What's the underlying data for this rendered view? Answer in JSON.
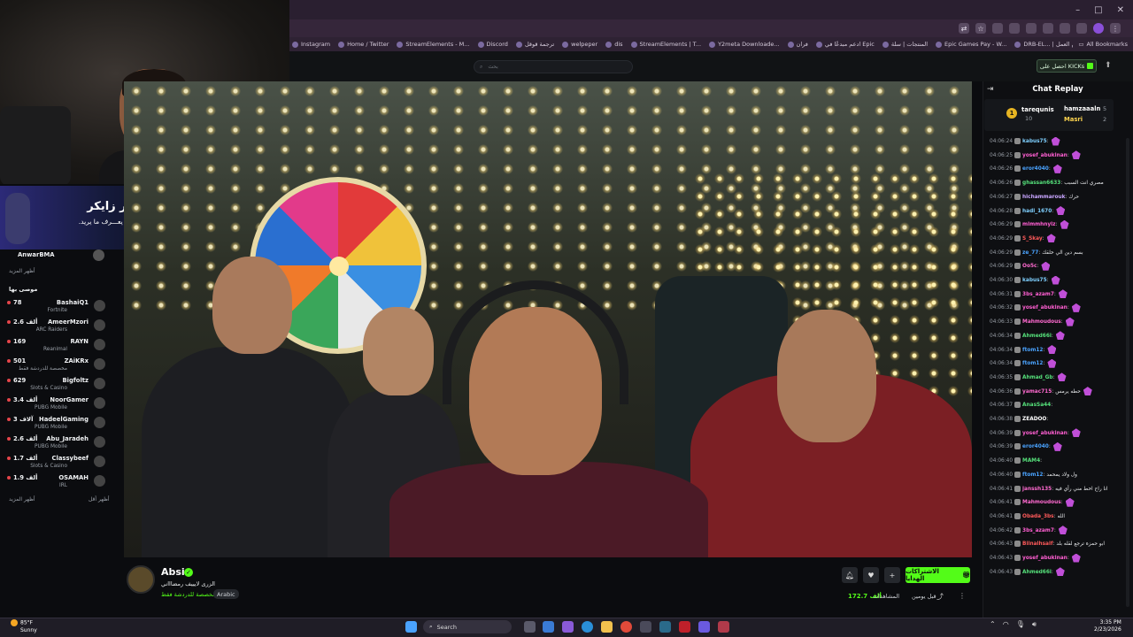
{
  "browser": {
    "bookmarks": [
      "Instagram",
      "Home / Twitter",
      "StreamElements - M...",
      "Discord",
      "ترجمة قوقل",
      "welpeper",
      "dis",
      "StreamElements | T...",
      "Y2meta Downloade...",
      "فران",
      "ادعم مبدعًا في Epic",
      "المنتجات | سلة",
      "Epic Games Pay - W...",
      "DRB-EL... | نقام العمل"
    ],
    "all_bookmarks": "All Bookmarks"
  },
  "header": {
    "search_placeholder": "بحث",
    "kick_button": "احصل على KICKs"
  },
  "store_banner": {
    "title": "متجر زايكر",
    "subtitle": "خيار من يعـــرف ما يريد."
  },
  "sidebar": {
    "top_item": "AnwarBMA",
    "show_more_top": "أظهر المزيد",
    "recommended_header": "موصى بها",
    "items": [
      {
        "count": "78",
        "name": "BashaiQ1",
        "category": "Fortnite",
        "avatar": "#6b6b6b"
      },
      {
        "count": "2.6 ألف",
        "name": "AmeerMzori",
        "category": "ARC Raiders",
        "avatar": "#b8322c"
      },
      {
        "count": "169",
        "name": "RAYN",
        "category": "Reanimal",
        "avatar": "#dcdcdc"
      },
      {
        "count": "501",
        "name": "ZAiKRx",
        "category": "مخصصة للدردشة فقط",
        "avatar": "#1a1a1a"
      },
      {
        "count": "629",
        "name": "Bigfoltz",
        "category": "Slots & Casino",
        "avatar": "#c4283a"
      },
      {
        "count": "3.4 ألف",
        "name": "NoorGamer",
        "category": "PUBG Mobile",
        "avatar": "#2a2a2a"
      },
      {
        "count": "3 آلاف",
        "name": "HadeelGaming",
        "category": "PUBG Mobile",
        "avatar": "#a56a4e"
      },
      {
        "count": "2.6 ألف",
        "name": "Abu_Jaradeh",
        "category": "PUBG Mobile",
        "avatar": "#3f8a3c"
      },
      {
        "count": "1.7 ألف",
        "name": "Classybeef",
        "category": "Slots & Casino",
        "avatar": "#2b3a7a"
      },
      {
        "count": "1.9 ألف",
        "name": "OSAMAH",
        "category": "IRL",
        "avatar": "#d0d0d0"
      }
    ],
    "show_more": "أظهر المزيد",
    "show_less": "أظهر أقل"
  },
  "stream": {
    "streamer": "Absi",
    "title": "الزرى لايييف رمضاااني",
    "category": "مخصصة للدردشة فقط",
    "language": "Arabic",
    "subscribe_button": "الاشتراكات الهدايا",
    "viewers": "172.7 ألف",
    "viewers_label": "المشاهدات",
    "uptime": "قبل يومين"
  },
  "chat": {
    "title": "Chat Replay",
    "leaderboard": [
      {
        "rank": "1",
        "name": "tarequnis",
        "count": "10"
      },
      {
        "name": "hamzaaaln",
        "count": "5"
      },
      {
        "name": "Masri",
        "count": "2"
      }
    ],
    "messages": [
      {
        "time": "04:06:24",
        "user": "kabus75",
        "color": "#7fd0ff",
        "emote": true,
        "text": ""
      },
      {
        "time": "04:06:25",
        "user": "yosef_abukinan",
        "color": "#ff5fd2",
        "emote": true,
        "text": ""
      },
      {
        "time": "04:06:26",
        "user": "eror4040",
        "color": "#4aa3ff",
        "emote": true,
        "text": ""
      },
      {
        "time": "04:06:26",
        "user": "ghassan6633",
        "color": "#55e07a",
        "emote": false,
        "text": "مصري انت السبب"
      },
      {
        "time": "04:06:27",
        "user": "hichammarouk",
        "color": "#c9a6ff",
        "emote": false,
        "text": "حرك"
      },
      {
        "time": "04:06:28",
        "user": "hadi_1670",
        "color": "#7fd0ff",
        "emote": true,
        "text": ""
      },
      {
        "time": "04:06:29",
        "user": "mlmmhnylz",
        "color": "#ff5fd2",
        "emote": true,
        "text": ""
      },
      {
        "time": "04:06:29",
        "user": "S_Skay",
        "color": "#ff5a5a",
        "emote": true,
        "text": ""
      },
      {
        "time": "04:06:29",
        "user": "ze_77",
        "color": "#4aa3ff",
        "emote": false,
        "text": "بسم دين الي خلقك"
      },
      {
        "time": "04:06:29",
        "user": "Oo5c",
        "color": "#ff6ad0",
        "emote": true,
        "text": ""
      },
      {
        "time": "04:06:30",
        "user": "kabus75",
        "color": "#7fd0ff",
        "emote": true,
        "text": ""
      },
      {
        "time": "04:06:31",
        "user": "3bs_azam7",
        "color": "#ff5fd2",
        "emote": true,
        "text": ""
      },
      {
        "time": "04:06:32",
        "user": "yosef_abukinan",
        "color": "#ff5fd2",
        "emote": true,
        "text": ""
      },
      {
        "time": "04:06:33",
        "user": "Mahmoudous",
        "color": "#ff6ad0",
        "emote": true,
        "text": ""
      },
      {
        "time": "04:06:34",
        "user": "Ahmed66i",
        "color": "#55e07a",
        "emote": true,
        "text": ""
      },
      {
        "time": "04:06:34",
        "user": "ftom12",
        "color": "#4aa3ff",
        "emote": true,
        "text": ""
      },
      {
        "time": "04:06:34",
        "user": "ftom12",
        "color": "#4aa3ff",
        "emote": true,
        "text": ""
      },
      {
        "time": "04:06:35",
        "user": "Ahmad_Gb",
        "color": "#55e07a",
        "emote": true,
        "text": ""
      },
      {
        "time": "04:06:36",
        "user": "yamac715",
        "color": "#ff6ad0",
        "emote": true,
        "text": "حطه يرمس"
      },
      {
        "time": "04:06:37",
        "user": "AnasSa44",
        "color": "#55e07a",
        "emote": false,
        "text": ""
      },
      {
        "time": "04:06:38",
        "user": "ZEADOO",
        "color": "#ffffff",
        "emote": false,
        "text": ""
      },
      {
        "time": "04:06:39",
        "user": "yosef_abukinan",
        "color": "#ff5fd2",
        "emote": true,
        "text": ""
      },
      {
        "time": "04:06:39",
        "user": "eror4040",
        "color": "#4aa3ff",
        "emote": true,
        "text": ""
      },
      {
        "time": "04:06:40",
        "user": "MAM4",
        "color": "#55e07a",
        "emote": false,
        "text": ""
      },
      {
        "time": "04:06:40",
        "user": "ftom12",
        "color": "#4aa3ff",
        "emote": false,
        "text": "ول ولاد يمحمد"
      },
      {
        "time": "04:06:41",
        "user": "janssh135",
        "color": "#ff6ad0",
        "emote": false,
        "text": "انا راح اخط مني رأي فيه"
      },
      {
        "time": "04:06:41",
        "user": "Mahmoudous",
        "color": "#ff6ad0",
        "emote": true,
        "text": ""
      },
      {
        "time": "04:06:41",
        "user": "Obada_3bs",
        "color": "#ff5a5a",
        "emote": false,
        "text": "الله"
      },
      {
        "time": "04:06:42",
        "user": "3bs_azam7",
        "color": "#ff5fd2",
        "emote": true,
        "text": ""
      },
      {
        "time": "04:06:43",
        "user": "Bilnalhsalf",
        "color": "#ff5a5a",
        "emote": false,
        "text": "ابو حمزة ترجع لقله بلد"
      },
      {
        "time": "04:06:43",
        "user": "yosef_abukinan",
        "color": "#ff5fd2",
        "emote": true,
        "text": ""
      },
      {
        "time": "04:06:43",
        "user": "Ahmed66i",
        "color": "#55e07a",
        "emote": true,
        "text": ""
      }
    ]
  },
  "taskbar": {
    "temperature": "85°F",
    "weather": "Sunny",
    "search": "Search",
    "time": "3:35 PM",
    "date": "2/23/2026"
  },
  "colors": {
    "accent": "#53fc18",
    "background": "#0b0c0f"
  }
}
